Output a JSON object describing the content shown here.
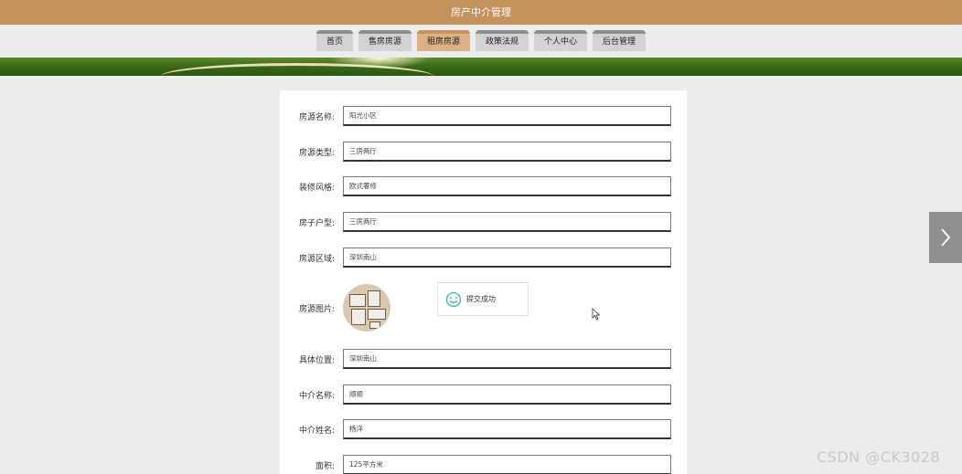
{
  "header": {
    "title": "房产中介管理"
  },
  "nav": {
    "items": [
      {
        "label": "首页"
      },
      {
        "label": "售房房源"
      },
      {
        "label": "租房房源"
      },
      {
        "label": "政策法规"
      },
      {
        "label": "个人中心"
      },
      {
        "label": "后台管理"
      }
    ],
    "active": "租房房源",
    "active_color": "#dcb185"
  },
  "form": {
    "house_name": {
      "label": "房源名称:",
      "value": "阳光小区"
    },
    "house_type": {
      "label": "房源类型:",
      "value": "三房两厅"
    },
    "decoration": {
      "label": "装修风格:",
      "value": "欧式奢修"
    },
    "layout": {
      "label": "房子户型:",
      "value": "三房两厅"
    },
    "region": {
      "label": "房源区域:",
      "value": "深圳南山"
    },
    "image": {
      "label": "房源图片:"
    },
    "address": {
      "label": "具体位置:",
      "value": "深圳南山"
    },
    "agency_name": {
      "label": "中介名称:",
      "value": "顺顺"
    },
    "agent_name": {
      "label": "中介姓名:",
      "value": "杨洋"
    },
    "area": {
      "label": "面积:",
      "value": "125平方米"
    }
  },
  "toast": {
    "icon": "smile-icon",
    "text": "提交成功",
    "color": "#3fb68b"
  },
  "watermark": {
    "text": "CSDN @CK3028"
  },
  "colors": {
    "header_bg": "#c5915c",
    "page_bg": "#ececec"
  }
}
